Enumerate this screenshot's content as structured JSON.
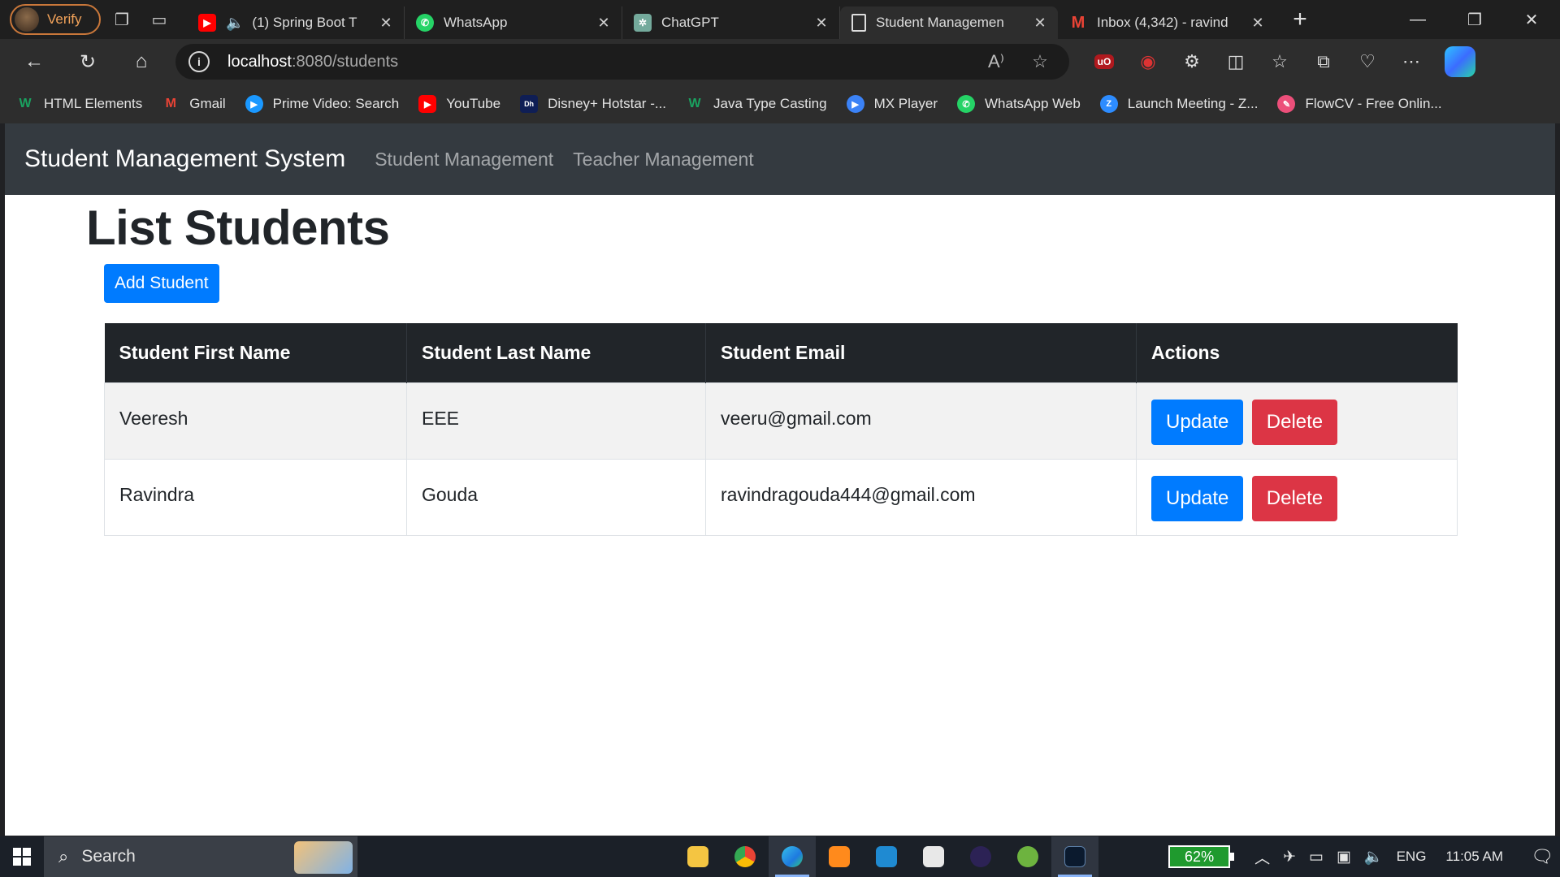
{
  "browser": {
    "profile_label": "Verify",
    "tabs": [
      {
        "title": "(1) Spring Boot T",
        "favicon": "youtube-icon",
        "color": "#ff0000"
      },
      {
        "title": "WhatsApp",
        "favicon": "whatsapp-icon",
        "color": "#25d366"
      },
      {
        "title": "ChatGPT",
        "favicon": "chatgpt-icon",
        "color": "#74aa9c"
      },
      {
        "title": "Student Managemen",
        "favicon": "page-icon",
        "color": "#dcdcdc"
      },
      {
        "title": "Inbox (4,342) - ravind",
        "favicon": "gmail-icon",
        "color": "#ea4335"
      }
    ],
    "url_host": "localhost",
    "url_path": ":8080/students",
    "bookmarks": [
      {
        "label": "HTML Elements",
        "color": "#1aa260"
      },
      {
        "label": "Gmail",
        "color": "#ea4335"
      },
      {
        "label": "Prime Video: Search",
        "color": "#1a98ff"
      },
      {
        "label": "YouTube",
        "color": "#ff0000"
      },
      {
        "label": "Disney+ Hotstar -...",
        "color": "#0f1e55"
      },
      {
        "label": "Java Type Casting",
        "color": "#1aa260"
      },
      {
        "label": "MX Player",
        "color": "#3b82f6"
      },
      {
        "label": "WhatsApp Web",
        "color": "#25d366"
      },
      {
        "label": "Launch Meeting - Z...",
        "color": "#2d8cff"
      },
      {
        "label": "FlowCV - Free Onlin...",
        "color": "#ec4f7a"
      }
    ]
  },
  "app": {
    "brand": "Student Management System",
    "nav": [
      "Student Management",
      "Teacher Management"
    ],
    "page_title": "List Students",
    "add_button": "Add Student",
    "table": {
      "headers": [
        "Student First Name",
        "Student Last Name",
        "Student Email",
        "Actions"
      ],
      "rows": [
        {
          "first": "Veeresh",
          "last": "EEE",
          "email": "veeru@gmail.com"
        },
        {
          "first": "Ravindra",
          "last": "Gouda",
          "email": "ravindragouda444@gmail.com"
        }
      ],
      "update_label": "Update",
      "delete_label": "Delete"
    }
  },
  "taskbar": {
    "search_placeholder": "Search",
    "battery": "62%",
    "language": "ENG",
    "time": "11:05 AM"
  }
}
